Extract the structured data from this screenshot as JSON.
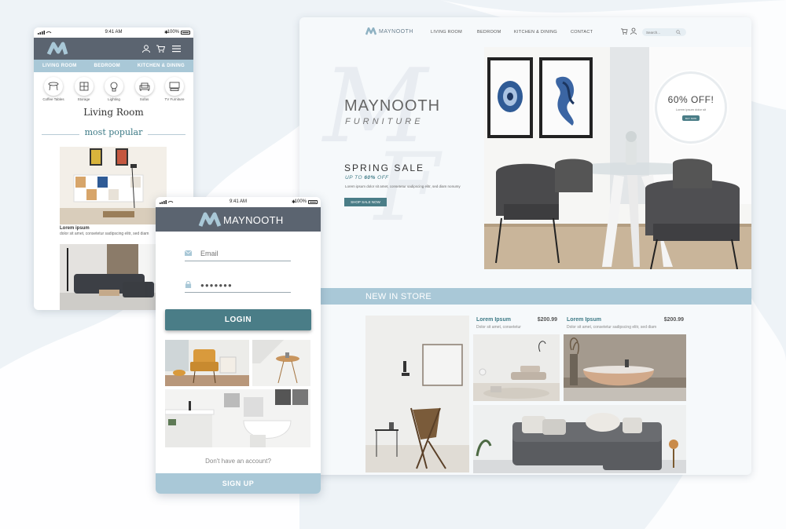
{
  "colors": {
    "accent": "#4a7d87",
    "light_blue": "#a9c8d7",
    "header_gray": "#5b6470",
    "background": "#eef3f7"
  },
  "desktop": {
    "brand": "MAYNOOTH",
    "nav": [
      "LIVING ROOM",
      "BEDROOM",
      "KITCHEN & DINING",
      "CONTACT"
    ],
    "search_placeholder": "Search...",
    "hero": {
      "title": "MAYNOOTH",
      "subtitle": "FURNITURE",
      "watermark_1": "M",
      "watermark_2": "F",
      "sale_title": "SPRING SALE",
      "sale_sub_prefix": "UP TO ",
      "sale_sub_percent": "60%",
      "sale_sub_suffix": " OFF",
      "sale_desc": "Lorem ipsum dolor sit amet, consetetur sadipscing elitr, sed diam nonumy",
      "shop_button": "SHOP SALE NOW"
    },
    "promo": {
      "headline": "60% OFF!",
      "text": "Lorem ipsum dolor sit",
      "button": "BUY NOW"
    },
    "new_in_store": "NEW IN STORE",
    "products": [
      {
        "name": "Lorem Ipsum",
        "price": "$200.99",
        "desc": "Dolor sit amet, consetetur"
      },
      {
        "name": "Lorem Ipsum",
        "price": "$200.99",
        "desc": "Dolor sit amet, consetetur sadipscing elitr, sed diam"
      }
    ]
  },
  "phone_shop": {
    "status": {
      "time": "9:41 AM",
      "battery": "100%"
    },
    "categories": [
      "LIVING ROOM",
      "BEDROOM",
      "KITCHEN & DINING"
    ],
    "subcategories": [
      {
        "label": "Coffee Tables",
        "icon": "coffee-table-icon"
      },
      {
        "label": "Storage",
        "icon": "storage-icon"
      },
      {
        "label": "Lighting",
        "icon": "lamp-icon"
      },
      {
        "label": "Sofas",
        "icon": "sofa-icon"
      },
      {
        "label": "TV Furniture",
        "icon": "tv-icon"
      }
    ],
    "title": "Living Room",
    "section": "most popular",
    "item": {
      "name": "Lorem ipsum",
      "desc": "dolor sit amet, consetetur sadipscing elitr, sed diam"
    }
  },
  "phone_login": {
    "status": {
      "time": "9:41 AM",
      "battery": "100%"
    },
    "brand": "MAYNOOTH",
    "email_placeholder": "Email",
    "password_value": "●●●●●●●",
    "login_button": "LOGIN",
    "no_account": "Don't have an account?",
    "signup_button": "SIGN UP"
  }
}
